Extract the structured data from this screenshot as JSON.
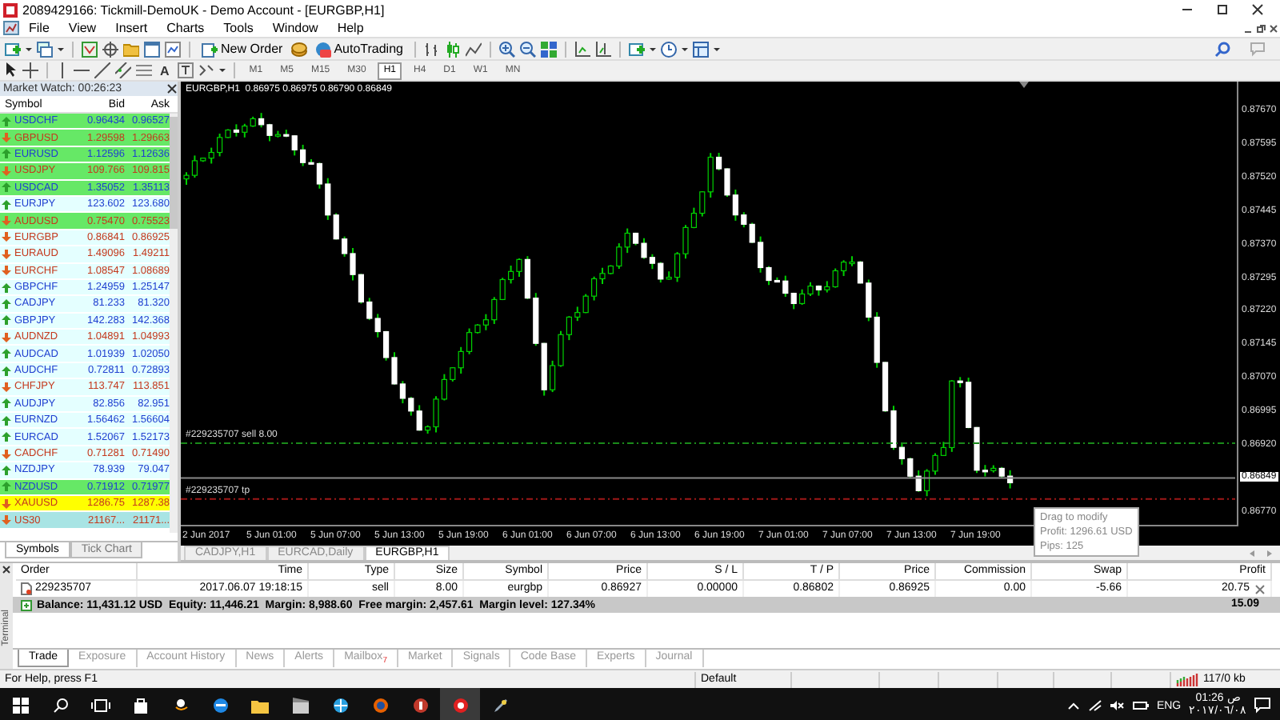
{
  "window": {
    "title": "2089429166: Tickmill-DemoUK - Demo Account - [EURGBP,H1]"
  },
  "menu": [
    "File",
    "View",
    "Insert",
    "Charts",
    "Tools",
    "Window",
    "Help"
  ],
  "toolbar": {
    "new_order": "New Order",
    "autotrading": "AutoTrading",
    "text_tool": "A",
    "timeframes": [
      {
        "label": "M1",
        "selected": false
      },
      {
        "label": "M5",
        "selected": false
      },
      {
        "label": "M15",
        "selected": false
      },
      {
        "label": "M30",
        "selected": false
      },
      {
        "label": "H1",
        "selected": true
      },
      {
        "label": "H4",
        "selected": false
      },
      {
        "label": "D1",
        "selected": false
      },
      {
        "label": "W1",
        "selected": false
      },
      {
        "label": "MN",
        "selected": false
      }
    ]
  },
  "market_watch": {
    "title": "Market Watch: 00:26:23",
    "columns": [
      "Symbol",
      "Bid",
      "Ask"
    ],
    "rows": [
      {
        "symbol": "USDCHF",
        "bid": "0.96434",
        "ask": "0.96527",
        "rising": true,
        "color": "#66e866"
      },
      {
        "symbol": "GBPUSD",
        "bid": "1.29598",
        "ask": "1.29663",
        "rising": false,
        "color": "#66e866"
      },
      {
        "symbol": "EURUSD",
        "bid": "1.12596",
        "ask": "1.12636",
        "rising": true,
        "color": "#66e866"
      },
      {
        "symbol": "USDJPY",
        "bid": "109.766",
        "ask": "109.815",
        "rising": false,
        "color": "#66e866"
      },
      {
        "symbol": "USDCAD",
        "bid": "1.35052",
        "ask": "1.35113",
        "rising": true,
        "color": "#66e866"
      },
      {
        "symbol": "EURJPY",
        "bid": "123.602",
        "ask": "123.680",
        "rising": true,
        "color": "#e4ffff"
      },
      {
        "symbol": "AUDUSD",
        "bid": "0.75470",
        "ask": "0.75523",
        "rising": false,
        "color": "#66e866"
      },
      {
        "symbol": "EURGBP",
        "bid": "0.86841",
        "ask": "0.86925",
        "rising": false,
        "color": "#e4ffff"
      },
      {
        "symbol": "EURAUD",
        "bid": "1.49096",
        "ask": "1.49211",
        "rising": false,
        "color": "#e4ffff"
      },
      {
        "symbol": "EURCHF",
        "bid": "1.08547",
        "ask": "1.08689",
        "rising": false,
        "color": "#e4ffff"
      },
      {
        "symbol": "GBPCHF",
        "bid": "1.24959",
        "ask": "1.25147",
        "rising": true,
        "color": "#e4ffff"
      },
      {
        "symbol": "CADJPY",
        "bid": "81.233",
        "ask": "81.320",
        "rising": true,
        "color": "#e4ffff"
      },
      {
        "symbol": "GBPJPY",
        "bid": "142.283",
        "ask": "142.368",
        "rising": true,
        "color": "#e4ffff"
      },
      {
        "symbol": "AUDNZD",
        "bid": "1.04891",
        "ask": "1.04993",
        "rising": false,
        "color": "#e4ffff"
      },
      {
        "symbol": "AUDCAD",
        "bid": "1.01939",
        "ask": "1.02050",
        "rising": true,
        "color": "#e4ffff"
      },
      {
        "symbol": "AUDCHF",
        "bid": "0.72811",
        "ask": "0.72893",
        "rising": true,
        "color": "#e4ffff"
      },
      {
        "symbol": "CHFJPY",
        "bid": "113.747",
        "ask": "113.851",
        "rising": false,
        "color": "#e4ffff"
      },
      {
        "symbol": "AUDJPY",
        "bid": "82.856",
        "ask": "82.951",
        "rising": true,
        "color": "#e4ffff"
      },
      {
        "symbol": "EURNZD",
        "bid": "1.56462",
        "ask": "1.56604",
        "rising": true,
        "color": "#e4ffff"
      },
      {
        "symbol": "EURCAD",
        "bid": "1.52067",
        "ask": "1.52173",
        "rising": true,
        "color": "#e4ffff"
      },
      {
        "symbol": "CADCHF",
        "bid": "0.71281",
        "ask": "0.71490",
        "rising": false,
        "color": "#e4ffff"
      },
      {
        "symbol": "NZDJPY",
        "bid": "78.939",
        "ask": "79.047",
        "rising": true,
        "color": "#e4ffff"
      },
      {
        "symbol": "NZDUSD",
        "bid": "0.71912",
        "ask": "0.71977",
        "rising": true,
        "color": "#66e866"
      },
      {
        "symbol": "XAUUSD",
        "bid": "1286.75",
        "ask": "1287.38",
        "rising": false,
        "color": "#ffff00"
      },
      {
        "symbol": "US30",
        "bid": "21167...",
        "ask": "21171...",
        "rising": false,
        "color": "#a8e4e4"
      }
    ],
    "tabs": [
      {
        "label": "Symbols",
        "selected": true
      },
      {
        "label": "Tick Chart",
        "selected": false
      }
    ]
  },
  "chart": {
    "header": "EURGBP,H1  0.86975 0.86975 0.86790 0.86849",
    "price_labels": [
      "0.87670",
      "0.87595",
      "0.87520",
      "0.87445",
      "0.87370",
      "0.87295",
      "0.87220",
      "0.87145",
      "0.87070",
      "0.86995",
      "0.86920",
      "0.86770"
    ],
    "current_price": "0.86849",
    "time_labels": [
      "2 Jun 2017",
      "5 Jun 01:00",
      "5 Jun 07:00",
      "5 Jun 13:00",
      "5 Jun 19:00",
      "6 Jun 01:00",
      "6 Jun 07:00",
      "6 Jun 13:00",
      "6 Jun 19:00",
      "7 Jun 01:00",
      "7 Jun 07:00",
      "7 Jun 13:00",
      "7 Jun 19:00"
    ],
    "order_lines": [
      {
        "kind": "sell",
        "label": "#229235707 sell 8.00"
      },
      {
        "kind": "tp",
        "label": "#229235707 tp"
      }
    ],
    "tooltip": [
      "Drag to modify",
      "Profit: 1296.61 USD",
      "Pips: 125"
    ]
  },
  "chart_tabs": [
    {
      "label": "CADJPY,H1",
      "selected": false
    },
    {
      "label": "EURCAD,Daily",
      "selected": false
    },
    {
      "label": "EURGBP,H1",
      "selected": true
    }
  ],
  "terminal": {
    "title": "Terminal",
    "columns": [
      "Order",
      "Time",
      "Type",
      "Size",
      "Symbol",
      "Price",
      "S / L",
      "T / P",
      "Price",
      "Commission",
      "Swap",
      "Profit"
    ],
    "orders": [
      {
        "order": "229235707",
        "time": "2017.06.07 19:18:15",
        "type": "sell",
        "size": "8.00",
        "symbol": "eurgbp",
        "price": "0.86927",
        "sl": "0.00000",
        "tp": "0.86802",
        "current_price": "0.86925",
        "commission": "0.00",
        "swap": "-5.66",
        "profit": "20.75"
      }
    ],
    "balance": "Balance: 11,431.12 USD  Equity: 11,446.21  Margin: 8,988.60  Free margin: 2,457.61  Margin level: 127.34%",
    "balance_profit": "15.09",
    "tabs": [
      {
        "label": "Trade",
        "selected": true
      },
      {
        "label": "Exposure",
        "selected": false
      },
      {
        "label": "Account History",
        "selected": false
      },
      {
        "label": "News",
        "selected": false
      },
      {
        "label": "Alerts",
        "selected": false
      },
      {
        "label": "Mailbox",
        "selected": false,
        "badge": "7"
      },
      {
        "label": "Market",
        "selected": false
      },
      {
        "label": "Signals",
        "selected": false
      },
      {
        "label": "Code Base",
        "selected": false
      },
      {
        "label": "Experts",
        "selected": false
      },
      {
        "label": "Journal",
        "selected": false
      }
    ]
  },
  "status_bar": {
    "help": "For Help, press F1",
    "profile": "Default",
    "traffic": "117/0 kb"
  },
  "taskbar": {
    "language": "ENG",
    "time": "01:26",
    "period": "ص",
    "date": "٢٠١٧/٠٦/٠٨"
  }
}
